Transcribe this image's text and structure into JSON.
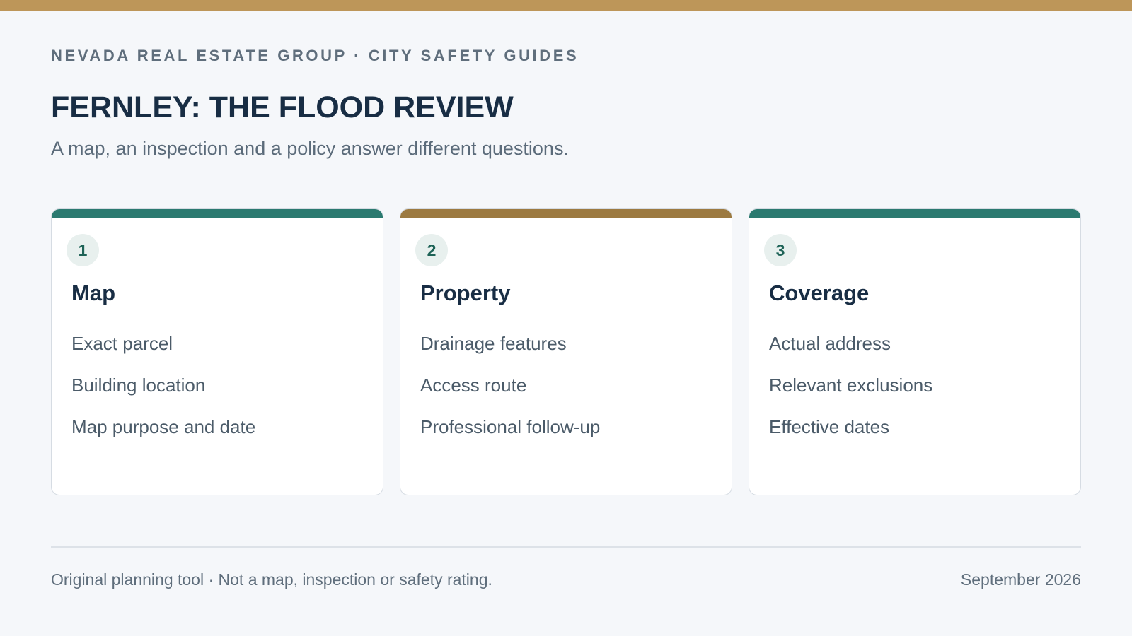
{
  "header": {
    "eyebrow": "NEVADA REAL ESTATE GROUP · CITY SAFETY GUIDES",
    "title": "FERNLEY: THE FLOOD REVIEW",
    "subtitle": "A map, an inspection and a policy answer different questions."
  },
  "cards": [
    {
      "number": "1",
      "heading": "Map",
      "items": [
        "Exact parcel",
        "Building location",
        "Map purpose and date"
      ]
    },
    {
      "number": "2",
      "heading": "Property",
      "items": [
        "Drainage features",
        "Access route",
        "Professional follow-up"
      ]
    },
    {
      "number": "3",
      "heading": "Coverage",
      "items": [
        "Actual address",
        "Relevant exclusions",
        "Effective dates"
      ]
    }
  ],
  "footer": {
    "note": "Original planning tool · Not a map, inspection or safety rating.",
    "date": "September 2026"
  },
  "colors": {
    "top_bar": "#bd9659",
    "accent_teal": "#2b7a70",
    "accent_gold": "#9c7a41",
    "heading_navy": "#182d44"
  }
}
